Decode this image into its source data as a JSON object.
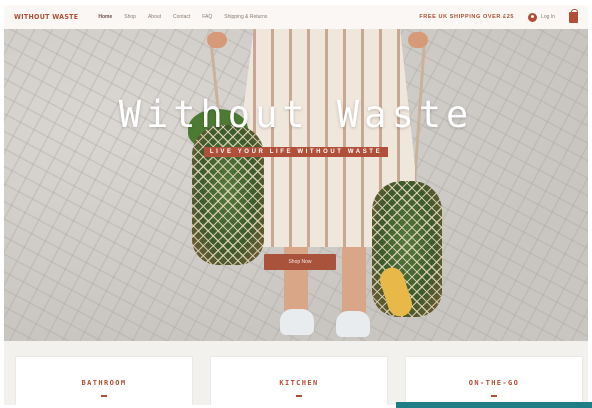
{
  "nav": {
    "logo": "WITHOUT WASTE",
    "menu": [
      {
        "label": "Home",
        "active": true
      },
      {
        "label": "Shop"
      },
      {
        "label": "About"
      },
      {
        "label": "Contact"
      },
      {
        "label": "FAQ"
      },
      {
        "label": "Shipping & Returns"
      }
    ],
    "promo": "FREE UK SHIPPING OVER £25",
    "login_label": "Log In",
    "icons": {
      "user": "user-circle-icon",
      "cart": "shopping-bag-icon"
    }
  },
  "hero": {
    "title": "Without Waste",
    "subtitle": "LIVE YOUR LIFE WITHOUT WASTE",
    "cta": "Shop Now"
  },
  "categories": [
    {
      "label": "BATHROOM"
    },
    {
      "label": "KITCHEN"
    },
    {
      "label": "ON-THE-GO"
    }
  ],
  "colors": {
    "accent": "#b04e36",
    "nav_bg": "#faf7f4",
    "button": "#a9533c",
    "teal": "#1f7d86"
  }
}
